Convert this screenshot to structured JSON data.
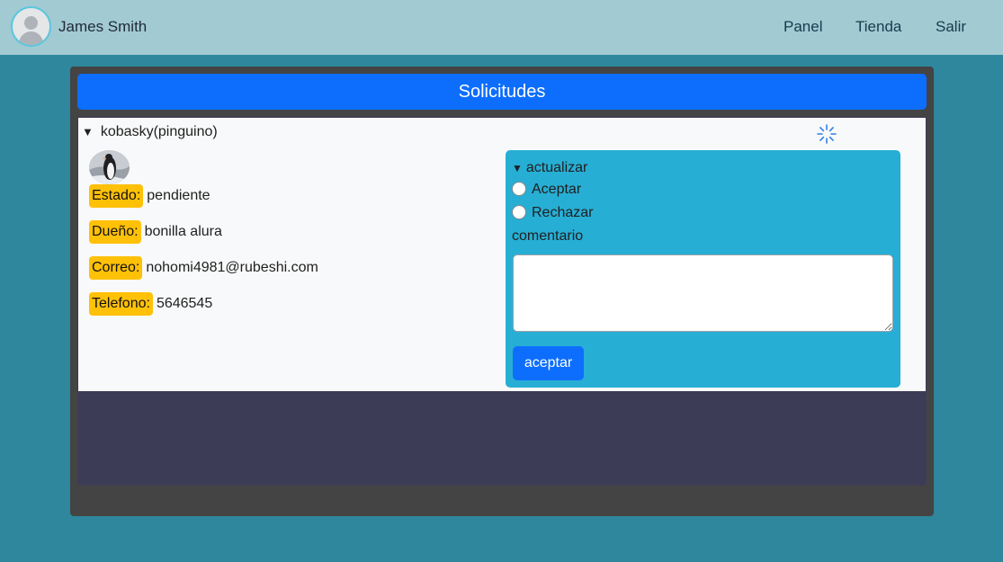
{
  "user": {
    "name": "James Smith"
  },
  "nav": {
    "panel": "Panel",
    "tienda": "Tienda",
    "salir": "Salir"
  },
  "page": {
    "title": "Solicitudes"
  },
  "request": {
    "summary": "kobasky(pinguino)",
    "fields": [
      {
        "label": "Estado:",
        "value": "pendiente"
      },
      {
        "label": "Dueño:",
        "value": "bonilla alura"
      },
      {
        "label": "Correo:",
        "value": "nohomi4981@rubeshi.com"
      },
      {
        "label": "Telefono:",
        "value": "5646545"
      }
    ]
  },
  "update": {
    "summary": "actualizar",
    "options": [
      "Aceptar",
      "Rechazar"
    ],
    "comment_label": "comentario",
    "comment_value": "",
    "submit_label": "aceptar"
  },
  "colors": {
    "page_background": "#2e879c",
    "topbar": "#a2cad3",
    "primary": "#0d6efd",
    "badge": "#ffc107",
    "update_box": "#27aed4",
    "panel": "#444444",
    "content_dark": "#3c3c56"
  },
  "icons": {
    "avatar": "user-avatar-icon",
    "spinner": "loading-spinner-icon",
    "caret": "triangle-down-icon"
  }
}
